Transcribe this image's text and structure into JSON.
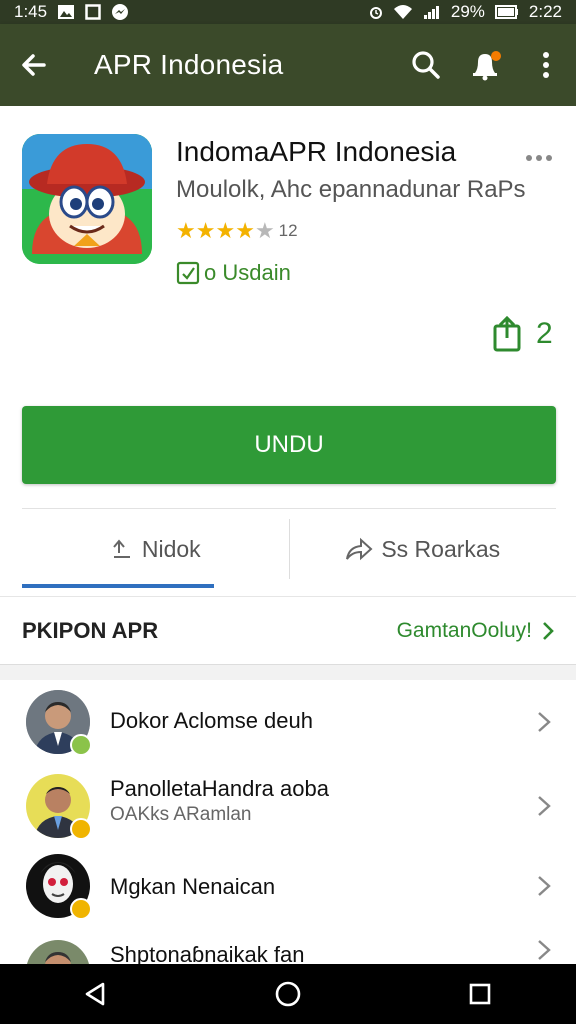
{
  "status_bar": {
    "time_left": "1:45",
    "battery": "29%",
    "time_right": "2:22"
  },
  "app_bar": {
    "title": "APR Indonesia",
    "icons": [
      "back-arrow-icon",
      "search-icon",
      "notification-bell-icon",
      "more-vert-icon"
    ]
  },
  "app": {
    "name": "IndomaAPR Indonesia",
    "developer": "Moulolk, Ahc epannadunar RaPs",
    "rating_stars": 4,
    "rating_count": "12",
    "installed_label": "o Usdain",
    "share_count": "2",
    "install_button": "UNDU"
  },
  "actions": {
    "left_label": "Nidok",
    "right_label": "Ss Roarkas"
  },
  "section": {
    "title": "PKIPON APR",
    "link": "GamtanOoluy!"
  },
  "list": [
    {
      "name": "Dokor Aclomse deuh",
      "sub": "",
      "badge_color": "#8bc34a"
    },
    {
      "name": "PanolletaHandra aoba",
      "sub": "OAKks ARamlan",
      "badge_color": "#f0b400"
    },
    {
      "name": "Mgkan Nenaican",
      "sub": "",
      "badge_color": "#f0b400"
    },
    {
      "name": "Shptonaɓnaikak fan",
      "sub": "",
      "badge_color": "#8bc34a"
    }
  ],
  "colors": {
    "app_bar": "#3b4a2a",
    "accent_green": "#2f9a37",
    "link_green": "#2e8a2e",
    "tab_underline": "#2f6fbf",
    "star": "#f3b200"
  }
}
